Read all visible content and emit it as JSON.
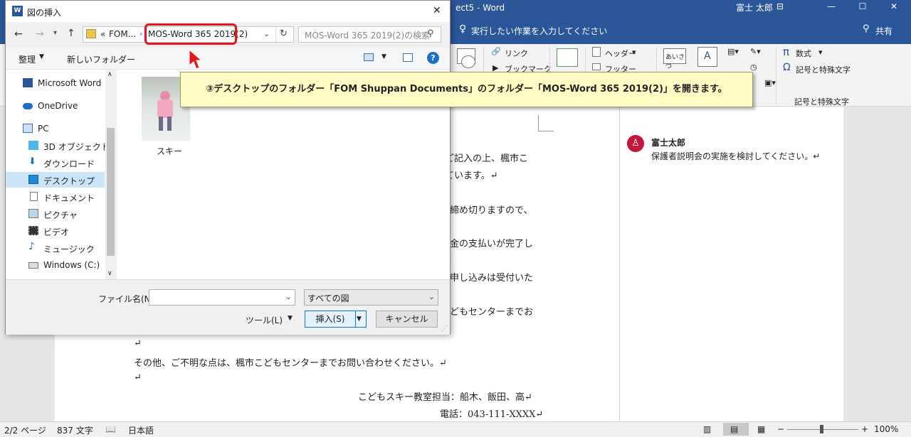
{
  "word": {
    "title": "ect5 - Word",
    "user": "富士 太郎",
    "tell_me": "実行したい作業を入力してください",
    "share": "共有",
    "ribbon": {
      "link": "リンク",
      "bookmark": "ブックマーク",
      "header": "ヘッダー",
      "footer": "フッター",
      "aisatsu": "あいさつ",
      "equation": "数式",
      "symbol": "記号と特殊文字",
      "group_symbols": "記号と特殊文字"
    }
  },
  "document": {
    "lines": [
      "ご記入の上、楓市こ",
      "ています。↵",
      "締め切りますので、",
      "金の支払いが完了し",
      "申し込みは受付いた",
      "どもセンターまでお",
      "↵",
      "その他、ご不明な点は、楓市こどもセンターまでお問い合わせください。↵",
      "↵",
      "こどもスキー教室担当：船木、飯田、高↵",
      "電話：043-111-XXXX↵"
    ]
  },
  "comment": {
    "author": "富士太郎",
    "text": "保護者説明会の実施を検討してください。↵"
  },
  "status": {
    "page": "2/2 ページ",
    "words": "837 文字",
    "language": "日本語",
    "zoom": "100%"
  },
  "dialog": {
    "title": "図の挿入",
    "breadcrumb_prefix": "«",
    "breadcrumb_parent": "FOM...",
    "breadcrumb_current": "MOS-Word 365 2019(2)",
    "search_placeholder": "MOS-Word 365 2019(2)の検索",
    "organize": "整理",
    "new_folder": "新しいフォルダー",
    "nav": [
      {
        "label": "Microsoft Word",
        "icon": "word-icon"
      },
      {
        "label": "OneDrive",
        "icon": "cloud-icon"
      },
      {
        "label": "PC",
        "icon": "computer-icon"
      },
      {
        "label": "3D オブジェクト",
        "icon": "cube-icon"
      },
      {
        "label": "ダウンロード",
        "icon": "download-icon"
      },
      {
        "label": "デスクトップ",
        "icon": "desktop-icon"
      },
      {
        "label": "ドキュメント",
        "icon": "document-icon"
      },
      {
        "label": "ピクチャ",
        "icon": "picture-icon"
      },
      {
        "label": "ビデオ",
        "icon": "video-icon"
      },
      {
        "label": "ミュージック",
        "icon": "music-icon"
      },
      {
        "label": "Windows (C:)",
        "icon": "drive-icon"
      }
    ],
    "file": {
      "name": "スキー"
    },
    "filename_label": "ファイル名(N):",
    "filetype": "すべての図",
    "tools": "ツール(L)",
    "insert": "挿入(S)",
    "cancel": "キャンセル"
  },
  "callout": {
    "text": "③デスクトップのフォルダー「FOM Shuppan Documents」のフォルダー「MOS-Word 365 2019(2)」を開きます。"
  },
  "colors": {
    "word_blue": "#2b579a",
    "callout_bg": "#fffcc4",
    "highlight_red": "#e3161d"
  }
}
